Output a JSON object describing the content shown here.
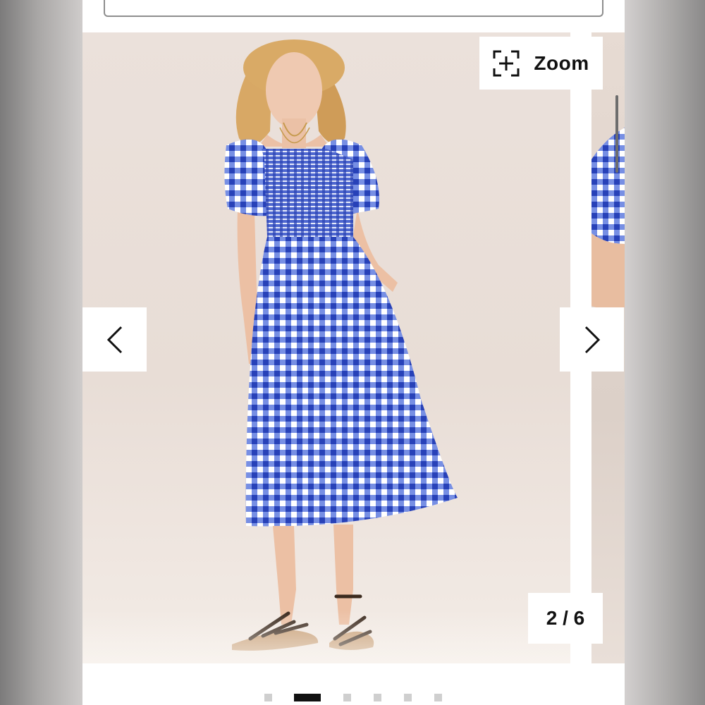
{
  "gallery": {
    "zoom_label": "Zoom",
    "counter_current": "2",
    "counter_total": "6",
    "counter_separator": " / ",
    "slide_count": 6,
    "active_slide_index": 1,
    "prev_icon": "chevron-left-icon",
    "next_icon": "chevron-right-icon",
    "zoom_icon": "expand-plus-icon"
  },
  "colors": {
    "gingham_blue": "#2f4fc9",
    "background": "#ebe1db",
    "active_dot": "#111111",
    "inactive_dot": "#cfcfcf"
  }
}
